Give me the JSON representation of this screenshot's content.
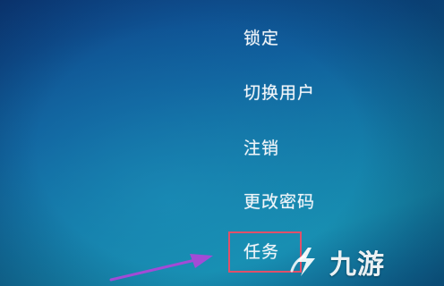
{
  "menu": {
    "items": [
      {
        "label": "锁定"
      },
      {
        "label": "切换用户"
      },
      {
        "label": "注销"
      },
      {
        "label": "更改密码"
      },
      {
        "label": "任务"
      }
    ],
    "highlighted_index": 4
  },
  "watermark": {
    "text": "九游",
    "icon": "jiuyou-logo-icon"
  },
  "annotation": {
    "arrow_color": "#a24bd6",
    "highlight_color": "#e0506a"
  }
}
